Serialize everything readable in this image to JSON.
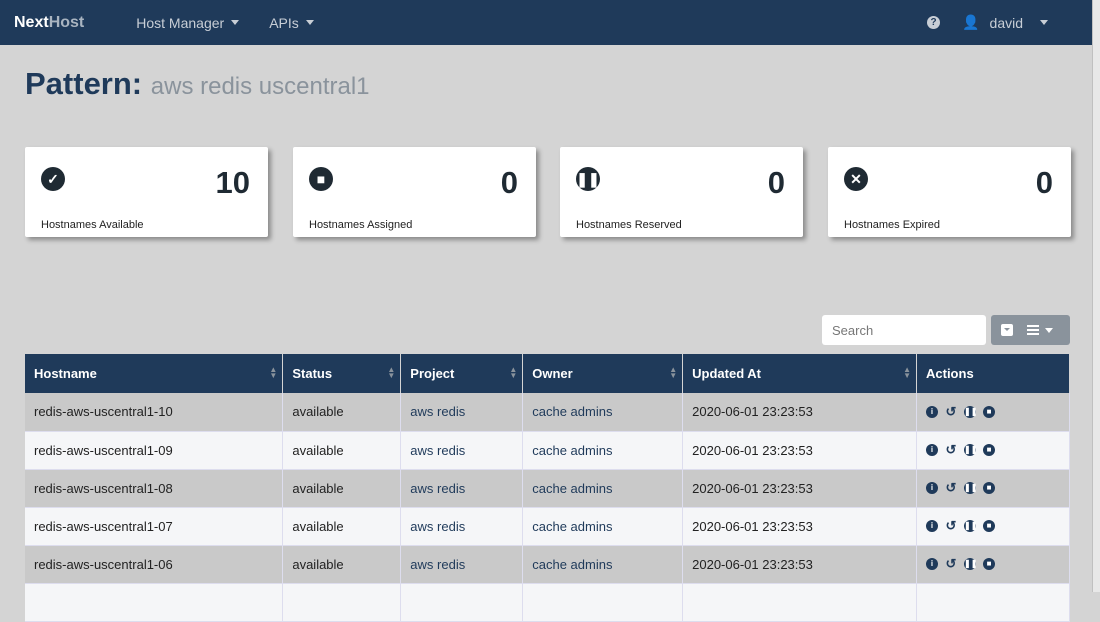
{
  "nav": {
    "brand_a": "Next",
    "brand_b": "Host",
    "items": [
      "Host Manager",
      "APIs"
    ],
    "user": "david"
  },
  "title": {
    "label": "Pattern:",
    "value": "aws redis uscentral1"
  },
  "cards": [
    {
      "icon": "check-circle-icon",
      "glyph": "✓",
      "count": "10",
      "label": "Hostnames Available"
    },
    {
      "icon": "stop-circle-icon",
      "glyph": "■",
      "count": "0",
      "label": "Hostnames Assigned"
    },
    {
      "icon": "pause-circle-icon",
      "glyph": "❚❚",
      "count": "0",
      "label": "Hostnames Reserved"
    },
    {
      "icon": "times-circle-icon",
      "glyph": "✕",
      "count": "0",
      "label": "Hostnames Expired"
    }
  ],
  "search": {
    "placeholder": "Search"
  },
  "table": {
    "headers": [
      "Hostname",
      "Status",
      "Project",
      "Owner",
      "Updated At",
      "Actions"
    ],
    "rows": [
      [
        "redis-aws-uscentral1-10",
        "available",
        "aws redis",
        "cache admins",
        "2020-06-01 23:23:53"
      ],
      [
        "redis-aws-uscentral1-09",
        "available",
        "aws redis",
        "cache admins",
        "2020-06-01 23:23:53"
      ],
      [
        "redis-aws-uscentral1-08",
        "available",
        "aws redis",
        "cache admins",
        "2020-06-01 23:23:53"
      ],
      [
        "redis-aws-uscentral1-07",
        "available",
        "aws redis",
        "cache admins",
        "2020-06-01 23:23:53"
      ],
      [
        "redis-aws-uscentral1-06",
        "available",
        "aws redis",
        "cache admins",
        "2020-06-01 23:23:53"
      ],
      [
        "",
        "",
        "",
        "",
        ""
      ]
    ]
  }
}
